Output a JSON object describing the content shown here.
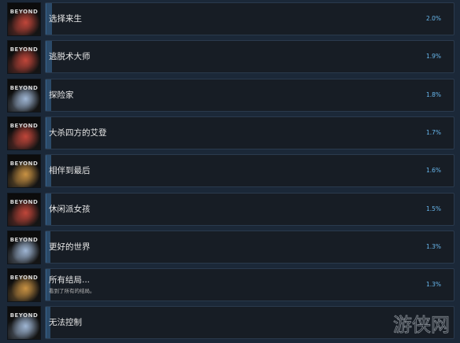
{
  "achievements": [
    {
      "name": "选择来生",
      "description": "",
      "percent": "2.0%",
      "percent_value": 2.0,
      "icon_theme": "red",
      "icon_label": "BEYOND"
    },
    {
      "name": "逃脱术大师",
      "description": "",
      "percent": "1.9%",
      "percent_value": 1.9,
      "icon_theme": "red",
      "icon_label": "BEYOND"
    },
    {
      "name": "探险家",
      "description": "",
      "percent": "1.8%",
      "percent_value": 1.8,
      "icon_theme": "blue",
      "icon_label": "BEYOND"
    },
    {
      "name": "大杀四方的艾登",
      "description": "",
      "percent": "1.7%",
      "percent_value": 1.7,
      "icon_theme": "red",
      "icon_label": "BEYOND"
    },
    {
      "name": "相伴到最后",
      "description": "",
      "percent": "1.6%",
      "percent_value": 1.6,
      "icon_theme": "gold",
      "icon_label": "BEYOND"
    },
    {
      "name": "休闲派女孩",
      "description": "",
      "percent": "1.5%",
      "percent_value": 1.5,
      "icon_theme": "red",
      "icon_label": "BEYOND"
    },
    {
      "name": "更好的世界",
      "description": "",
      "percent": "1.3%",
      "percent_value": 1.3,
      "icon_theme": "blue",
      "icon_label": "BEYOND"
    },
    {
      "name": "所有结局...",
      "description": "看到了所有的结局。",
      "percent": "1.3%",
      "percent_value": 1.3,
      "icon_theme": "gold",
      "icon_label": "BEYOND"
    },
    {
      "name": "无法控制",
      "description": "",
      "percent": "",
      "percent_value": null,
      "icon_theme": "blue",
      "icon_label": "BEYOND"
    }
  ],
  "icon_themes": {
    "red": "#c0463a",
    "blue": "#9fb6d4",
    "gold": "#c99243"
  },
  "watermark": {
    "text": "游侠网",
    "icon": "youxia-logo-icon"
  },
  "colors": {
    "background": "#1b2838",
    "card": "#171d25",
    "progress": "#2b4a69",
    "percent_text": "#68b8ee"
  }
}
